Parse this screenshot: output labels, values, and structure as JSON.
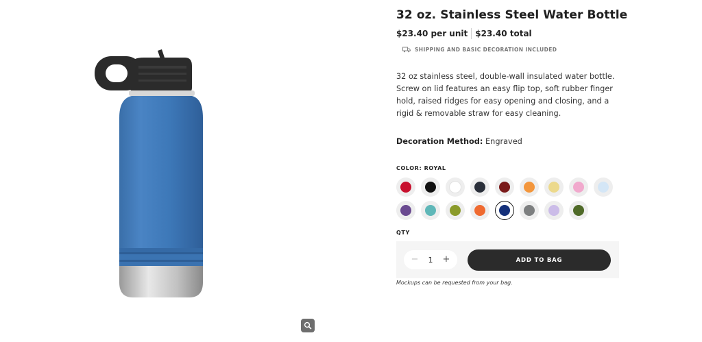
{
  "product": {
    "title": "32 oz. Stainless Steel Water Bottle",
    "price_per_unit": "$23.40 per unit",
    "price_total": "$23.40 total",
    "shipping_note": "SHIPPING AND BASIC DECORATION INCLUDED",
    "description": "32 oz stainless steel, double-wall insulated water bottle. Screw on lid features an easy flip top, soft rubber finger hold, raised ridges for easy opening and closing, and a rigid & removable straw for easy cleaning.",
    "decoration_label": "Decoration Method:",
    "decoration_value": "Engraved"
  },
  "color": {
    "label": "COLOR: ROYAL",
    "selected": "Royal",
    "swatches": [
      {
        "hex": "#c8102e"
      },
      {
        "hex": "#111111"
      },
      {
        "hex": "#ffffff"
      },
      {
        "hex": "#2a2f3a"
      },
      {
        "hex": "#7a1a1a"
      },
      {
        "hex": "#f3963c"
      },
      {
        "hex": "#ecd98c"
      },
      {
        "hex": "#f1a9cd"
      },
      {
        "hex": "#d4e6f6"
      },
      {
        "hex": "#6a4a90"
      },
      {
        "hex": "#5fb7b8"
      },
      {
        "hex": "#8a9a2a"
      },
      {
        "hex": "#ef6a30"
      },
      {
        "hex": "#14307a"
      },
      {
        "hex": "#7d7f80"
      },
      {
        "hex": "#cbbce8"
      },
      {
        "hex": "#4f6a28"
      }
    ]
  },
  "quantity": {
    "label": "QTY",
    "value": "1",
    "minus": "−",
    "plus": "+"
  },
  "actions": {
    "add_to_bag": "ADD TO BAG",
    "mockup_note": "Mockups can be requested from your bag."
  },
  "icons": {
    "zoom": "magnifier-icon",
    "shipping": "truck-icon"
  },
  "bottle": {
    "body_color": "#3d78b8",
    "lid_color": "#2b2b2b"
  }
}
